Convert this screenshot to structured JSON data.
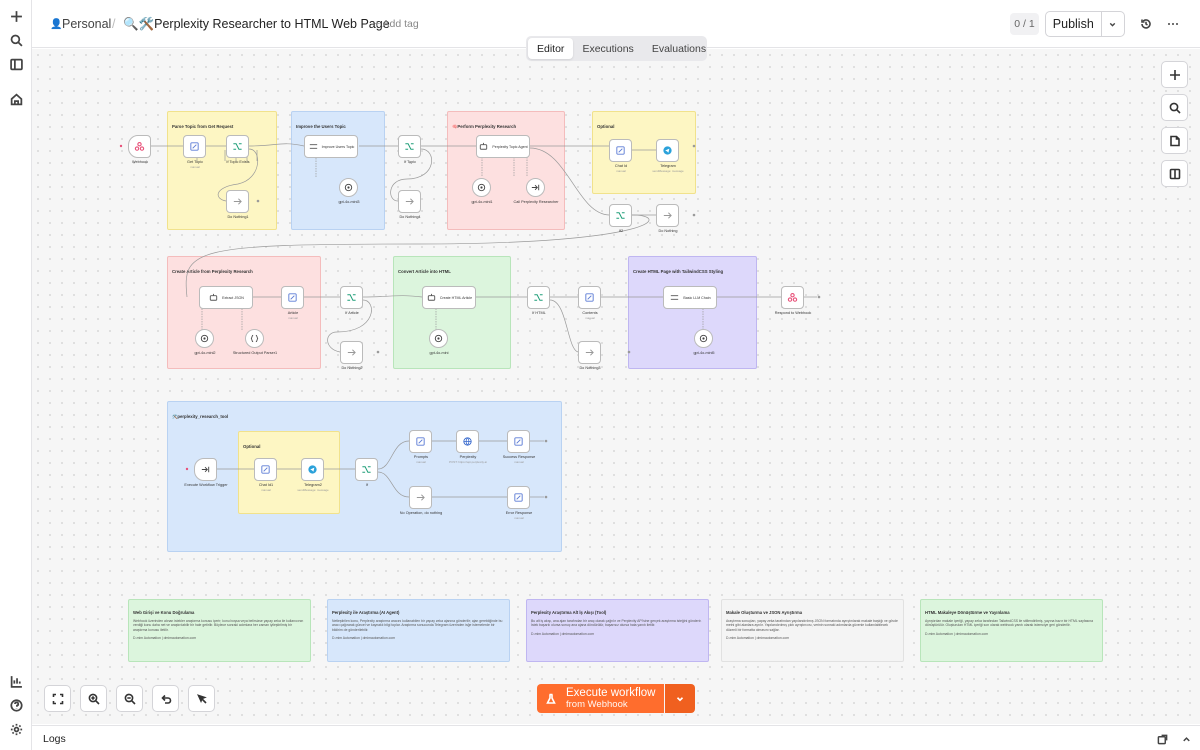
{
  "header": {
    "breadcrumb_project": "Personal",
    "breadcrumb_sep": "/",
    "workflow_title": "🔍🛠️Perplexity Researcher to HTML Web Page",
    "add_tag": "+ Add tag",
    "counter": "0 / 1",
    "publish": "Publish"
  },
  "tabs": [
    "Editor",
    "Executions",
    "Evaluations"
  ],
  "active_tab": "Editor",
  "stickies": {
    "parse": "Parse Topic from Get Request",
    "improve": "Improve the Users Topic",
    "perform": "🧠Perform Perplexity Research",
    "optional1": "Optional",
    "create_article": "Create Article from Perplexity Research",
    "convert": "Convert Article into HTML",
    "create_page": "Create HTML Page with TailwindCSS Styling",
    "tool": "🛠️perplexity_research_tool",
    "optional2": "Optional"
  },
  "nodes": {
    "webhook": "Webhook",
    "get_topic": "Get Topic",
    "get_topic_sub": "manual",
    "if_topic_exists": "If Topic Exists",
    "do_nothing1": "Do Nothing1",
    "improve_topic": "Improve Users Topic",
    "gpt_a": "gpt-4o-mini3",
    "if_topic": "If Topic",
    "do_nothing4": "Do Nothing4",
    "perplexity_agent": "Perplexity Topic Agent",
    "gpt_b": "gpt-4o-mini1",
    "call_researcher": "Call Perplexity Researcher",
    "chat_id": "Chat Id",
    "chat_id_sub": "manual",
    "telegram": "Telegram",
    "telegram_sub": "sendMessage: message",
    "if2": "If2",
    "do_nothing": "Do Nothing",
    "extract_json": "Extract JSON",
    "gpt_c": "gpt-4o-mini2",
    "structured_parser": "Structured Output Parser1",
    "article": "Article",
    "article_sub": "manual",
    "if_article": "If Article",
    "do_nothing2": "Do Nothing2",
    "create_html_article": "Create HTML Article",
    "gpt_d": "gpt-4o-mini",
    "if_html": "If HTML",
    "contents": "Contents",
    "contents_sub": "manual",
    "do_nothing3": "Do Nothing3",
    "basic_llm": "Basic LLM Chain",
    "gpt_e": "gpt-4o-mini5",
    "respond": "Respond to Webhook",
    "exec_trigger": "Execute Workflow Trigger",
    "chat_id1": "Chat Id1",
    "chat_id1_sub": "manual",
    "telegram2": "Telegram2",
    "telegram2_sub": "sendMessage: message",
    "if": "If",
    "prompts": "Prompts",
    "prompts_sub": "manual",
    "perplexity": "Perplexity",
    "perplexity_sub": "POST: https://api.perplexity.ai",
    "success_response": "Success Response",
    "success_response_sub": "manual",
    "no_operation": "No Operation, do nothing",
    "error_response": "Error Response",
    "error_response_sub": "manual"
  },
  "info_notes": [
    {
      "title": "Web Girişi ve Konu Doğrulama",
      "body": "Webhook üzerinden alınan istekler araştırma konusu içerir; konu boşsa veya belirsizse yapay zeka ile kullanıcının verdiği konu daha net ve araştırılabilir bir hale getirilir. Böylece sonraki adımlara her zaman iyileştirilmiş bir araştırma konusu iletilir.",
      "footer": "D-mim Automation | dmimautomation.com",
      "color": "green"
    },
    {
      "title": "Perplexity ile Araştırma (AI Agent)",
      "body": "Netleştirilen konu, Perplexity araştırma aracını kullanabilen bir yapay zeka ajanına gönderilir; ajan gerektiğinde bu aracı çağırarak güncel ve kaynaklı bilgi toplar. Araştırma sonucunda Telegram üzerinden isğe istemelerde bir bildirim de gönderilebilir.",
      "footer": "D-mim Automation | dmimautomation.com",
      "color": "blue"
    },
    {
      "title": "Perplexity Araştırma Alt İş Akışı (Tool)",
      "body": "Bu alt iş akışı, ana ajan tarafından bir araç olarak çağrılır ve Perplexity API'sine gerçek araştırma isteğini gönderir. İstek başarılı olursa sonuç ana ajana döndürülür, başarısız olursa hata yanıtı iletilir.",
      "footer": "D-mim Automation | dmimautomation.com",
      "color": "purple"
    },
    {
      "title": "Makale Oluşturma ve JSON Ayrıştırma",
      "body": "Araştırma sonuçları, yapay zeka tarafından yapılandırılmış JSON formatında ayrıştırılarak makale başlığı ve gövde metni gibi alanlara ayrılır. Yapılandırılmış çıktı ayrıştırıcısı, verinin sonraki adımlarda güvenle kullanılabilecek düzenli bir formatta olmasını sağlar.",
      "footer": "D-mim Automation | dmimautomation.com",
      "color": "gray"
    },
    {
      "title": "HTML Makaleye Dönüştürme ve Yayınlama",
      "body": "Ayrıştırılan makale içeriği, yapay zeka tarafından TailwindCSS ile stillendirilmiş, yayına hazır bir HTML sayfasına dönüştürülür. Oluşturulan HTML içeriği son olarak webhook yanıtı olarak istemciye geri gönderilir.",
      "footer": "D-mim Automation | dmimautomation.com",
      "color": "green"
    }
  ],
  "execute": {
    "line1": "Execute workflow",
    "line2": "from Webhook"
  },
  "logs": {
    "label": "Logs"
  },
  "colors": {
    "accent": "#ff6d2d",
    "accent_dark": "#f0601f",
    "trigger_icon": "#e8527a"
  }
}
